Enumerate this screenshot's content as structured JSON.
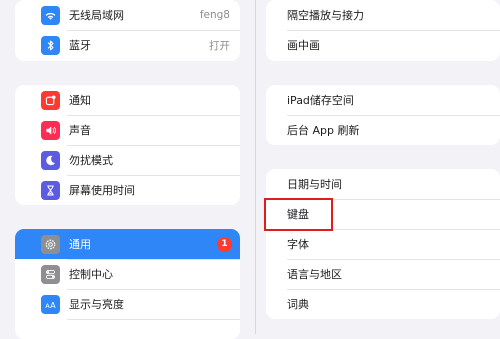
{
  "left": {
    "group1": [
      {
        "label": "无线局域网",
        "value": "feng8",
        "icon": "wifi-icon",
        "color": "#2f86f6"
      },
      {
        "label": "蓝牙",
        "value": "打开",
        "icon": "bluetooth-icon",
        "color": "#2f86f6"
      }
    ],
    "group2": [
      {
        "label": "通知",
        "icon": "notifications-icon",
        "color": "#fb3b30"
      },
      {
        "label": "声音",
        "icon": "speaker-icon",
        "color": "#fb2d55"
      },
      {
        "label": "勿扰模式",
        "icon": "moon-icon",
        "color": "#5c5ce0"
      },
      {
        "label": "屏幕使用时间",
        "icon": "hourglass-icon",
        "color": "#5c5ce0"
      }
    ],
    "group3": [
      {
        "label": "通用",
        "badge": "1",
        "icon": "gear-icon",
        "color": "#8e8e93"
      },
      {
        "label": "控制中心",
        "icon": "toggles-icon",
        "color": "#8e8e93"
      },
      {
        "label": "显示与亮度",
        "icon": "display-icon",
        "color": "#2f86f6"
      }
    ]
  },
  "right": {
    "group1": [
      "隔空播放与接力",
      "画中画"
    ],
    "group2": [
      "iPad储存空间",
      "后台 App 刷新"
    ],
    "group3": [
      "日期与时间",
      "键盘",
      "字体",
      "语言与地区",
      "词典"
    ]
  },
  "colors": {
    "selected": "#2f86f6",
    "badge": "#ff3b30",
    "highlight": "#e21b1b"
  }
}
